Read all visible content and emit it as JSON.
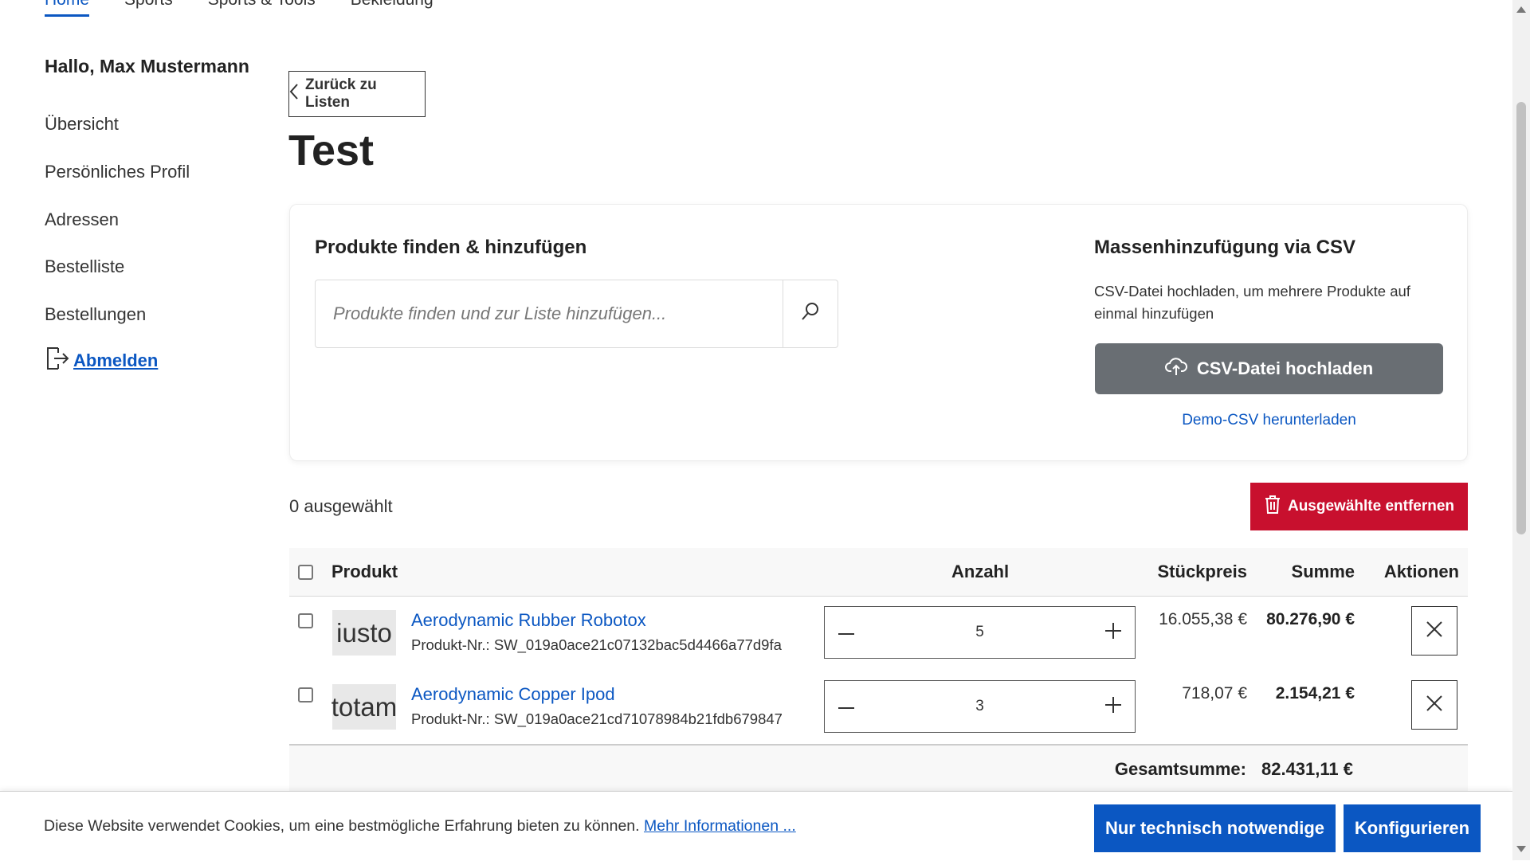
{
  "topnav": {
    "items": [
      {
        "label": "Home",
        "active": true
      },
      {
        "label": "Sports",
        "active": false
      },
      {
        "label": "Sports & Tools",
        "active": false
      },
      {
        "label": "Bekleidung",
        "active": false
      }
    ]
  },
  "sidebar": {
    "greeting": "Hallo, Max Mustermann",
    "items": [
      {
        "label": "Übersicht"
      },
      {
        "label": "Persönliches Profil"
      },
      {
        "label": "Adressen"
      },
      {
        "label": "Bestelliste"
      },
      {
        "label": "Bestellungen"
      }
    ],
    "logout": {
      "label": "Abmelden",
      "icon": "logout-icon"
    }
  },
  "back_button": {
    "label": "Zurück zu Listen",
    "icon": "chevron-left-icon"
  },
  "page_title": "Test",
  "search_section": {
    "title": "Produkte finden & hinzufügen",
    "placeholder": "Produkte finden und zur Liste hinzufügen...",
    "value": "",
    "icon": "search-icon"
  },
  "csv_section": {
    "title": "Massenhinzufügung via CSV",
    "description": "CSV-Datei hochladen, um mehrere Produkte auf einmal hinzufügen",
    "upload_label": "CSV-Datei hochladen",
    "upload_icon": "cloud-upload-icon",
    "demo_link": "Demo-CSV herunterladen"
  },
  "selection": {
    "count_text": "0 ausgewählt",
    "remove_label": "Ausgewählte entfernen",
    "remove_icon": "trash-icon"
  },
  "table": {
    "headers": {
      "product": "Produkt",
      "quantity": "Anzahl",
      "unit_price": "Stückpreis",
      "sum": "Summe",
      "actions": "Aktionen"
    },
    "rows": [
      {
        "thumb": "iusto",
        "name": "Aerodynamic Rubber Robotox",
        "number": "Produkt-Nr.: SW_019a0ace21c07132bac5d4466a77d9fa",
        "quantity": "5",
        "unit_price": "16.055,38 €",
        "sum": "80.276,90 €"
      },
      {
        "thumb": "totam",
        "name": "Aerodynamic Copper Ipod",
        "number": "Produkt-Nr.: SW_019a0ace21cd71078984b21fdb679847",
        "quantity": "3",
        "unit_price": "718,07 €",
        "sum": "2.154,21 €"
      }
    ],
    "total_label": "Gesamtsumme:",
    "total_value": "82.431,11 €"
  },
  "cookie_banner": {
    "text": "Diese Website verwendet Cookies, um eine bestmögliche Erfahrung bieten zu können.",
    "link": "Mehr Informationen ...",
    "btn_necessary": "Nur technisch notwendige",
    "btn_configure": "Konfigurieren"
  },
  "colors": {
    "accent": "#0b57c2",
    "danger": "#c8102e",
    "upload_button": "#696e73"
  }
}
